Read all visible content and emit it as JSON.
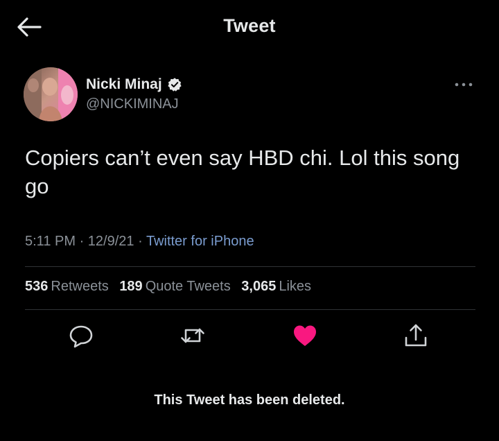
{
  "header": {
    "title": "Tweet"
  },
  "author": {
    "name": "Nicki Minaj",
    "handle": "@NICKIMINAJ",
    "verified": true
  },
  "tweet": {
    "text": "Copiers can’t even say HBD chi. Lol this song go",
    "time": "5:11 PM",
    "date": "12/9/21",
    "source": "Twitter for iPhone"
  },
  "stats": {
    "retweets_count": "536",
    "retweets_label": "Retweets",
    "quotes_count": "189",
    "quotes_label": "Quote Tweets",
    "likes_count": "3,065",
    "likes_label": "Likes"
  },
  "actions": {
    "reply_icon": "reply-icon",
    "retweet_icon": "retweet-icon",
    "like_icon": "heart-icon",
    "share_icon": "share-icon",
    "liked": true
  },
  "notice": {
    "text": "This Tweet has been deleted."
  },
  "colors": {
    "background": "#000000",
    "like_active": "#f91880",
    "link": "#7a9ccf",
    "verified_badge": "#e7e9ea"
  }
}
